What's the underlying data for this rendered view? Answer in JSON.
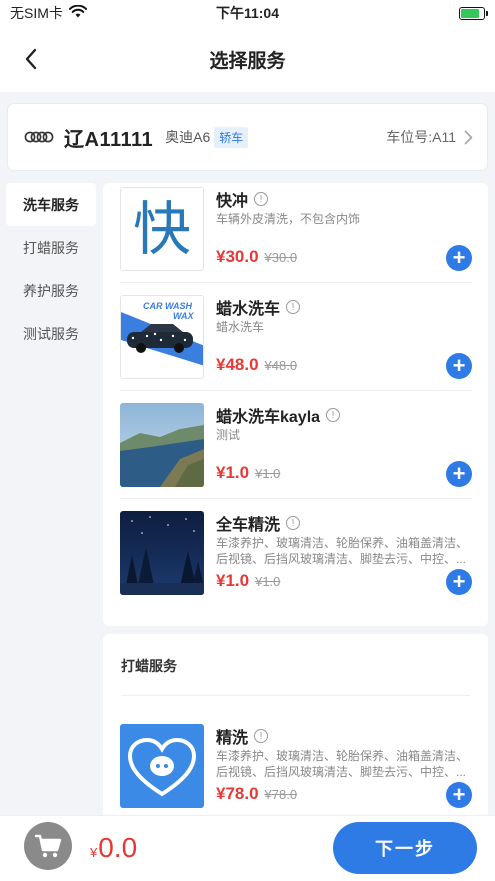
{
  "status_bar": {
    "carrier": "无SIM卡",
    "time": "下午11:04",
    "battery_level": 0.8
  },
  "nav": {
    "title": "选择服务",
    "back_icon": "chevron-left-icon"
  },
  "car": {
    "brand_logo": "audi-logo",
    "plate": "辽A11111",
    "model": "奥迪A6",
    "type_tag": "轿车",
    "parking": "车位号:A11"
  },
  "sidebar": {
    "items": [
      {
        "label": "洗车服务",
        "active": true
      },
      {
        "label": "打蜡服务",
        "active": false
      },
      {
        "label": "养护服务",
        "active": false
      },
      {
        "label": "测试服务",
        "active": false
      }
    ]
  },
  "wash_services": [
    {
      "name": "快冲",
      "desc": "车辆外皮清洗，不包含内饰",
      "price": "¥30.0",
      "orig": "¥30.0",
      "thumb_text": "快"
    },
    {
      "name": "蜡水洗车",
      "desc": "蜡水洗车",
      "price": "¥48.0",
      "orig": "¥48.0",
      "thumb_text": "CAR WASH",
      "thumb_text2": "WAX"
    },
    {
      "name": "蜡水洗车kayla",
      "desc": "测试",
      "price": "¥1.0",
      "orig": "¥1.0"
    },
    {
      "name": "全车精洗",
      "desc": "车漆养护、玻璃清洁、轮胎保养、油箱盖清洁、后视镜、后挡风玻璃清洁、脚垫去污、中控、...",
      "price": "¥1.0",
      "orig": "¥1.0"
    }
  ],
  "wax_section": {
    "title": "打蜡服务",
    "services": [
      {
        "name": "精洗",
        "desc": "车漆养护、玻璃清洁、轮胎保养、油箱盖清洁、后视镜、后挡风玻璃清洁、脚垫去污、中控、...",
        "price": "¥78.0",
        "orig": "¥78.0"
      }
    ]
  },
  "bottom": {
    "currency": "¥",
    "total": "0.0",
    "next_label": "下一步"
  },
  "colors": {
    "accent": "#2f7be6",
    "price": "#e53935",
    "background": "#f2f4f7"
  }
}
